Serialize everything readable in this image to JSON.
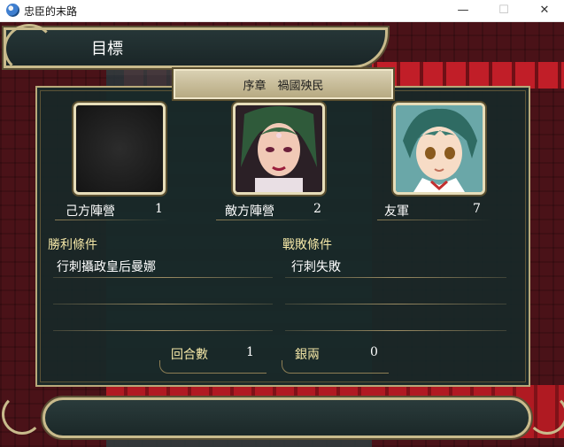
{
  "window": {
    "title": "忠臣的末路",
    "minimize_glyph": "—",
    "maximize_glyph": "☐",
    "close_glyph": "✕"
  },
  "header": {
    "title": "目標"
  },
  "chapter": {
    "title": "序章　禍國殃民"
  },
  "sides": [
    {
      "label": "己方陣營",
      "count": "1"
    },
    {
      "label": "敵方陣營",
      "count": "2"
    },
    {
      "label": "友軍",
      "count": "7"
    }
  ],
  "victory": {
    "title": "勝利條件",
    "items": [
      "行刺攝政皇后曼娜"
    ]
  },
  "defeat": {
    "title": "戰敗條件",
    "items": [
      "行刺失敗"
    ]
  },
  "stats": {
    "turns_label": "回合數",
    "turns_value": "1",
    "money_label": "銀兩",
    "money_value": "0"
  },
  "colors": {
    "frame_gold": "#c9bb8c",
    "panel_bg": "#182828",
    "section_title": "#f3e6a6",
    "carpet_red": "#b01a22"
  }
}
